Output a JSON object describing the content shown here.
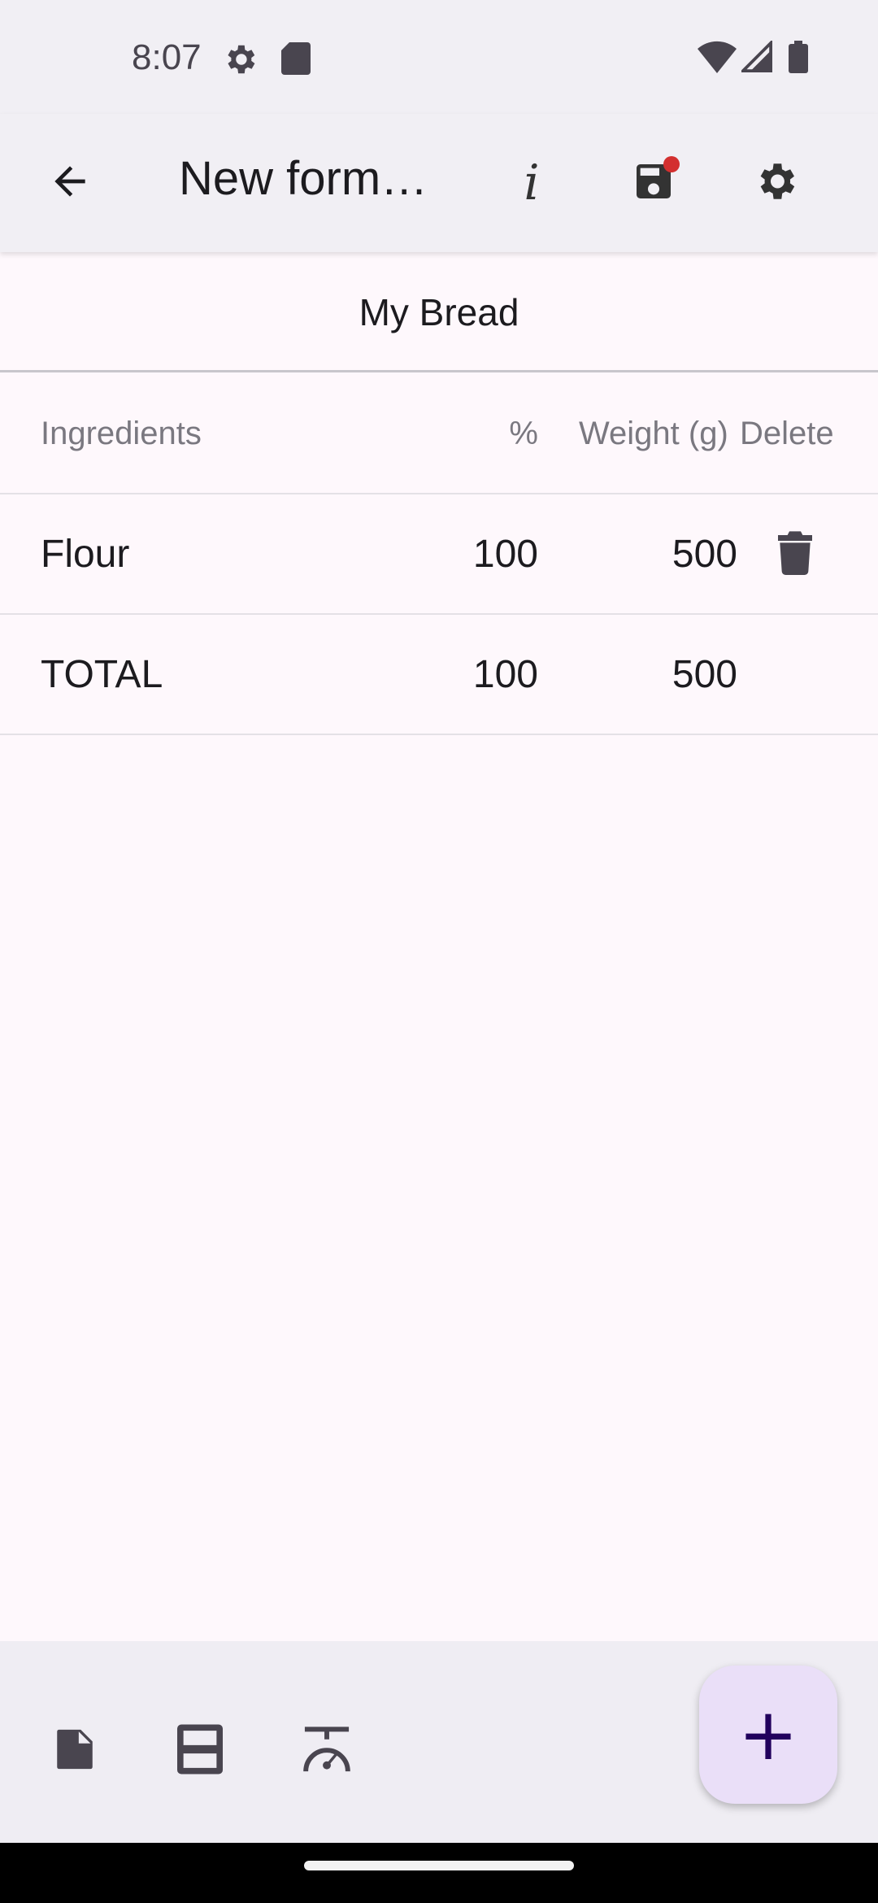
{
  "status_bar": {
    "time": "8:07",
    "icons": [
      "settings-gear-icon",
      "sd-card-icon",
      "wifi-icon",
      "signal-icon",
      "battery-icon"
    ]
  },
  "app_bar": {
    "title": "New form…",
    "back_icon": "arrow-back-icon",
    "actions": [
      "info-icon",
      "save-icon",
      "settings-icon"
    ],
    "save_badge_color": "#d32f2f"
  },
  "recipe": {
    "name": "My Bread"
  },
  "table": {
    "headers": {
      "ingredients": "Ingredients",
      "percent": "%",
      "weight": "Weight (g)",
      "delete": "Delete"
    },
    "rows": [
      {
        "name": "Flour",
        "percent": "100",
        "weight": "500"
      }
    ],
    "total": {
      "name": "TOTAL",
      "percent": "100",
      "weight": "500"
    }
  },
  "bottom_bar": {
    "nav_icons": [
      "document-icon",
      "table-view-icon",
      "scale-icon"
    ],
    "fab_label": "+"
  },
  "colors": {
    "background": "#fef8fc",
    "bar": "#f1eff4",
    "fab": "#eadff8",
    "fab_icon": "#21005d"
  }
}
